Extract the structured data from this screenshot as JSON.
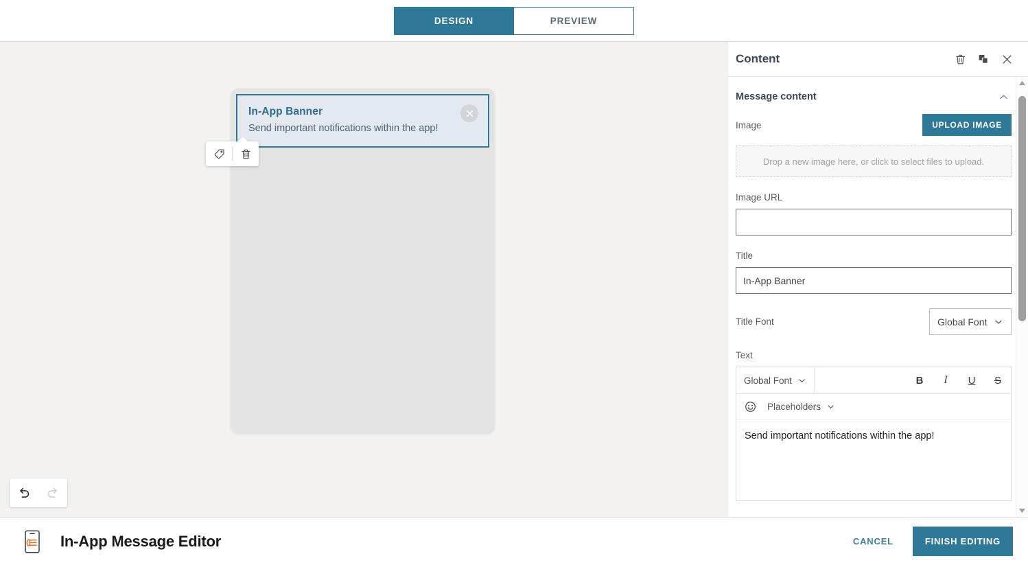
{
  "topbar": {
    "design_label": "DESIGN",
    "preview_label": "PREVIEW"
  },
  "canvas": {
    "banner": {
      "title": "In-App Banner",
      "text": "Send important notifications within the app!",
      "close_icon": "close-circle-icon"
    },
    "element_toolbar": {
      "tag_icon": "tag-icon",
      "delete_icon": "trash-icon"
    },
    "history": {
      "undo_icon": "undo-icon",
      "redo_icon": "redo-icon"
    }
  },
  "panel": {
    "title": "Content",
    "header_icons": {
      "delete": "trash-icon",
      "duplicate": "duplicate-icon",
      "close": "close-icon"
    },
    "section": {
      "title": "Message content",
      "collapse_icon": "chevron-up-icon"
    },
    "image": {
      "label": "Image",
      "upload_label": "UPLOAD IMAGE",
      "dropzone_text": "Drop a new image here, or click to select files to upload."
    },
    "image_url": {
      "label": "Image URL",
      "value": "",
      "placeholder": ""
    },
    "title_field": {
      "label": "Title",
      "value": "In-App Banner"
    },
    "title_font": {
      "label": "Title Font",
      "value": "Global Font"
    },
    "text_field": {
      "label": "Text",
      "font_value": "Global Font",
      "bold_label": "B",
      "italic_label": "I",
      "underline_label": "U",
      "strike_label": "S",
      "emoji_icon": "emoji-icon",
      "placeholders_label": "Placeholders",
      "content": "Send important notifications within the app!"
    }
  },
  "footer": {
    "app_icon": "mobile-device-icon",
    "title": "In-App Message Editor",
    "cancel_label": "CANCEL",
    "finish_label": "FINISH EDITING"
  },
  "colors": {
    "accent": "#2e7898",
    "banner_bg": "#e3e9ee",
    "canvas_bg": "#f3f2f1",
    "phone_bg": "#e5e4e4",
    "icon_orange": "#f26522"
  }
}
